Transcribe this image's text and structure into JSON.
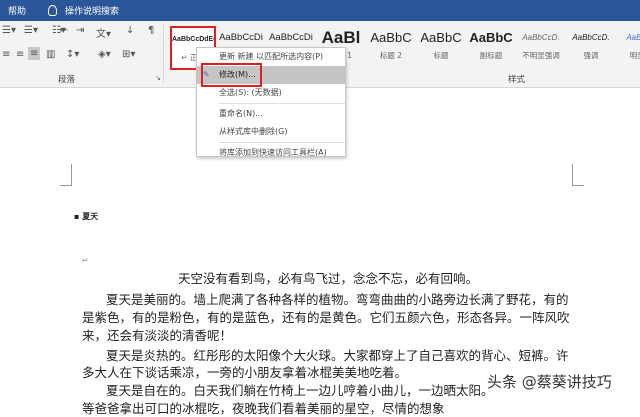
{
  "titlebar": {
    "help": "帮助",
    "search": "操作说明搜索"
  },
  "ribbon": {
    "paragraph_group": "段落",
    "styles_group": "样式",
    "styles": [
      {
        "preview": "AaBbCcDdEe",
        "label": "↵ 正文"
      },
      {
        "preview": "AaBbCcDi",
        "label": ""
      },
      {
        "preview": "AaBbCcDi",
        "label": ""
      },
      {
        "preview": "AaBl",
        "label": "标题 1"
      },
      {
        "preview": "AaBbC",
        "label": "标题 2"
      },
      {
        "preview": "AaBbC",
        "label": "标题"
      },
      {
        "preview": "AaBbC",
        "label": "副标题"
      },
      {
        "preview": "AaBbCcD.",
        "label": "不明显强调"
      },
      {
        "preview": "AaBbCcD.",
        "label": "强调"
      },
      {
        "preview": "AaBbCc",
        "label": "明显强"
      }
    ]
  },
  "context_menu": {
    "items": [
      "更新 新建 以匹配所选内容(P)",
      "修改(M)...",
      "全选(S): (无数据)",
      "重命名(N)...",
      "从样式库中删除(G)",
      "将库添加到快速访问工具栏(A)"
    ]
  },
  "document": {
    "heading": "夏天",
    "lines": [
      "天空没有看到鸟，必有鸟飞过，念念不忘，必有回响。",
      "夏天是美丽的。墙上爬满了各种各样的植物。弯弯曲曲的小路旁边长满了野花，有的",
      "是紫色，有的是粉色，有的是蓝色，还有的是黄色。它们五颜六色，形态各异。一阵风吹",
      "来，还会有淡淡的清香呢！",
      "夏天是炎热的。红彤彤的太阳像个大火球。大家都穿上了自己喜欢的背心、短裤。许",
      "多大人在下谈话乘凉，一旁的小朋友拿着冰棍美美地吃着。",
      "夏天是自在的。白天我们躺在竹椅上一边儿哼着小曲儿，一边晒太阳。",
      "等爸爸拿出可口的冰棍吃，夜晚我们看着美丽的星空，尽情的想象"
    ]
  },
  "watermark": "头条 @蔡葵讲技巧"
}
